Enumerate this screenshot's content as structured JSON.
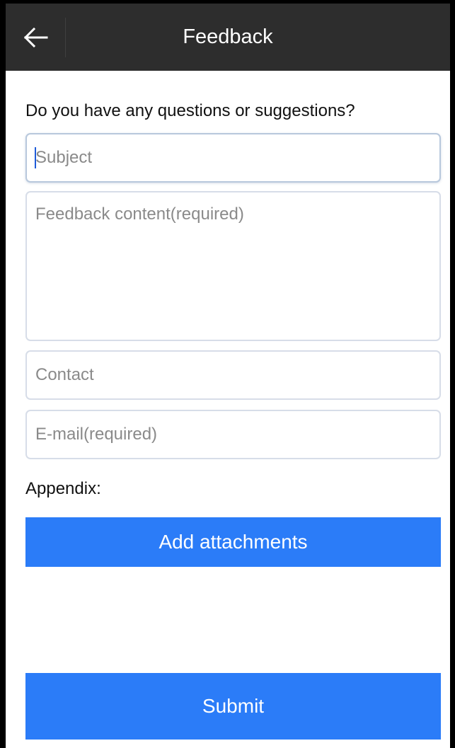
{
  "app_bar": {
    "title": "Feedback",
    "back_icon": "arrow-left-icon",
    "background": "#2d2d2d"
  },
  "form": {
    "question": "Do you have any questions or suggestions?",
    "subject": {
      "value": "",
      "placeholder": "Subject"
    },
    "content": {
      "value": "",
      "placeholder": "Feedback content(required)"
    },
    "contact": {
      "value": "",
      "placeholder": "Contact"
    },
    "email": {
      "value": "",
      "placeholder": "E-mail(required)"
    },
    "appendix_label": "Appendix:",
    "add_attachments_label": "Add attachments",
    "submit_label": "Submit"
  },
  "colors": {
    "accent": "#2b7cf8",
    "field_border": "#d7dde8"
  }
}
